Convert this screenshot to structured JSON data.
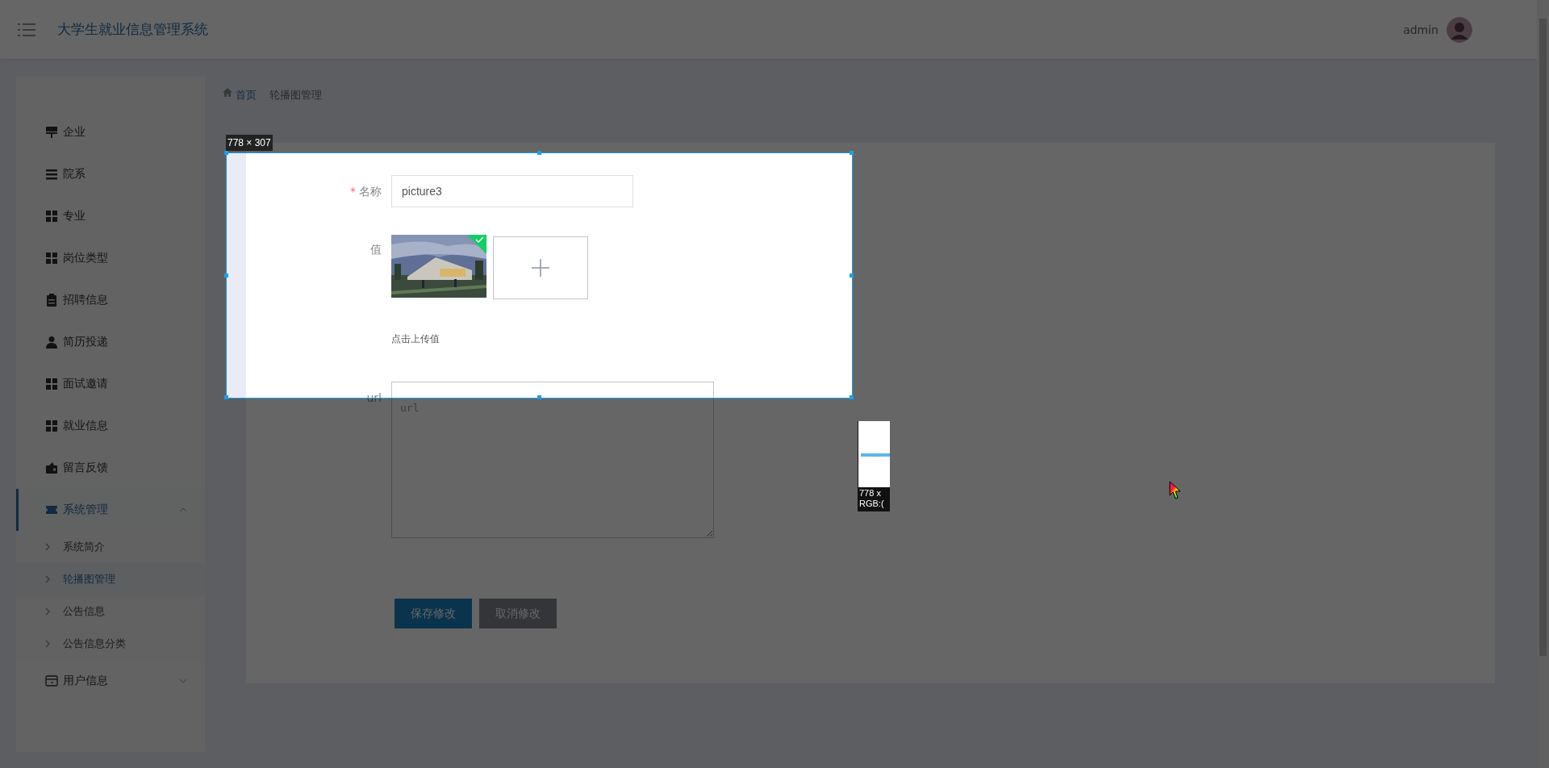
{
  "header": {
    "title": "大学生就业信息管理系统",
    "user": "admin"
  },
  "sidebar": {
    "items": [
      {
        "label": "企业",
        "kind": "flag",
        "selected": false
      },
      {
        "label": "院系",
        "kind": "list",
        "selected": false
      },
      {
        "label": "专业",
        "kind": "grid",
        "selected": false
      },
      {
        "label": "岗位类型",
        "kind": "grid",
        "selected": false
      },
      {
        "label": "招聘信息",
        "kind": "clipboard",
        "selected": false
      },
      {
        "label": "简历投递",
        "kind": "person",
        "selected": false
      },
      {
        "label": "面试邀请",
        "kind": "grid",
        "selected": false
      },
      {
        "label": "就业信息",
        "kind": "grid",
        "selected": false
      },
      {
        "label": "留言反馈",
        "kind": "wallet",
        "selected": false
      },
      {
        "label": "系统管理",
        "kind": "ticket",
        "selected": true,
        "expanded": true,
        "children": [
          {
            "label": "系统简介",
            "selected": false
          },
          {
            "label": "轮播图管理",
            "selected": true
          },
          {
            "label": "公告信息",
            "selected": false
          },
          {
            "label": "公告信息分类",
            "selected": false
          }
        ]
      },
      {
        "label": "用户信息",
        "kind": "card",
        "selected": false,
        "expanded": false
      }
    ]
  },
  "breadcrumb": [
    "首页",
    "轮播图管理"
  ],
  "form": {
    "name": {
      "label": "名称",
      "required_mark": "*",
      "value": "picture3"
    },
    "value": {
      "label": "值",
      "uploaded": true,
      "hint": "点击上传值"
    },
    "url": {
      "label": "url",
      "placeholder": "url"
    },
    "buttons": [
      {
        "label": "保存修改",
        "kind": "primary"
      },
      {
        "label": "取消修改",
        "kind": "secondary"
      }
    ]
  },
  "capture": {
    "size_label": "778 × 307",
    "magnifier": [
      "778 x",
      "RGB:("
    ]
  }
}
